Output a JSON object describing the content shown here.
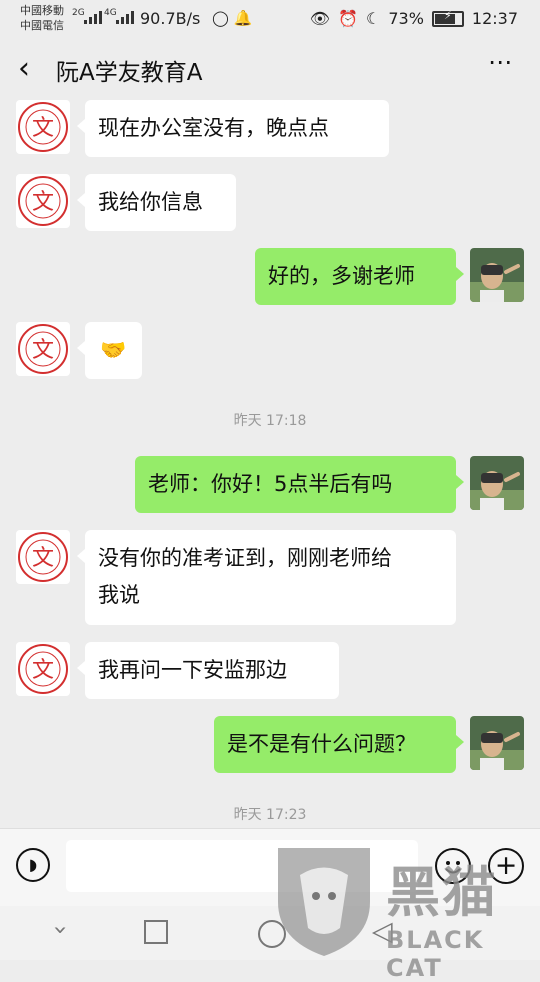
{
  "status_bar": {
    "carrier1": "中國移動",
    "carrier2": "中國電信",
    "net1": "2G",
    "net2": "4G",
    "net_speed": "90.7B/s",
    "battery": "73%",
    "time": "12:37"
  },
  "header": {
    "back_icon": "chevron-left",
    "title": "阮A学友教育A",
    "more_icon": "more-dots"
  },
  "messages": [
    {
      "side": "left",
      "text": "现在办公室没有，晚点点"
    },
    {
      "side": "left",
      "text": "我给你信息"
    },
    {
      "side": "right",
      "text": "好的，多谢老师"
    },
    {
      "side": "left",
      "emoji": "🤝"
    },
    {
      "timestamp": "昨天 17:18"
    },
    {
      "side": "right",
      "text": "老师：你好！5点半后有吗"
    },
    {
      "side": "left",
      "text_line1": "没有你的准考证到，刚刚老师给",
      "text_line2": "我说"
    },
    {
      "side": "left",
      "text": "我再问一下安监那边"
    },
    {
      "side": "right",
      "text": "是不是有什么问题？"
    },
    {
      "timestamp": "昨天 17:23"
    }
  ],
  "teacher_avatar_text": "KEWEN EDUCATION",
  "input_bar": {
    "voice_icon": "voice-icon",
    "emoji_icon": "emoji-icon",
    "plus_icon": "plus-icon"
  },
  "watermark": {
    "cn": "黑猫",
    "en": "BLACK CAT"
  },
  "colors": {
    "background": "#ededed",
    "bubble_right": "#95ec69",
    "bubble_left": "#ffffff",
    "teacher_logo": "#d32f2f"
  }
}
